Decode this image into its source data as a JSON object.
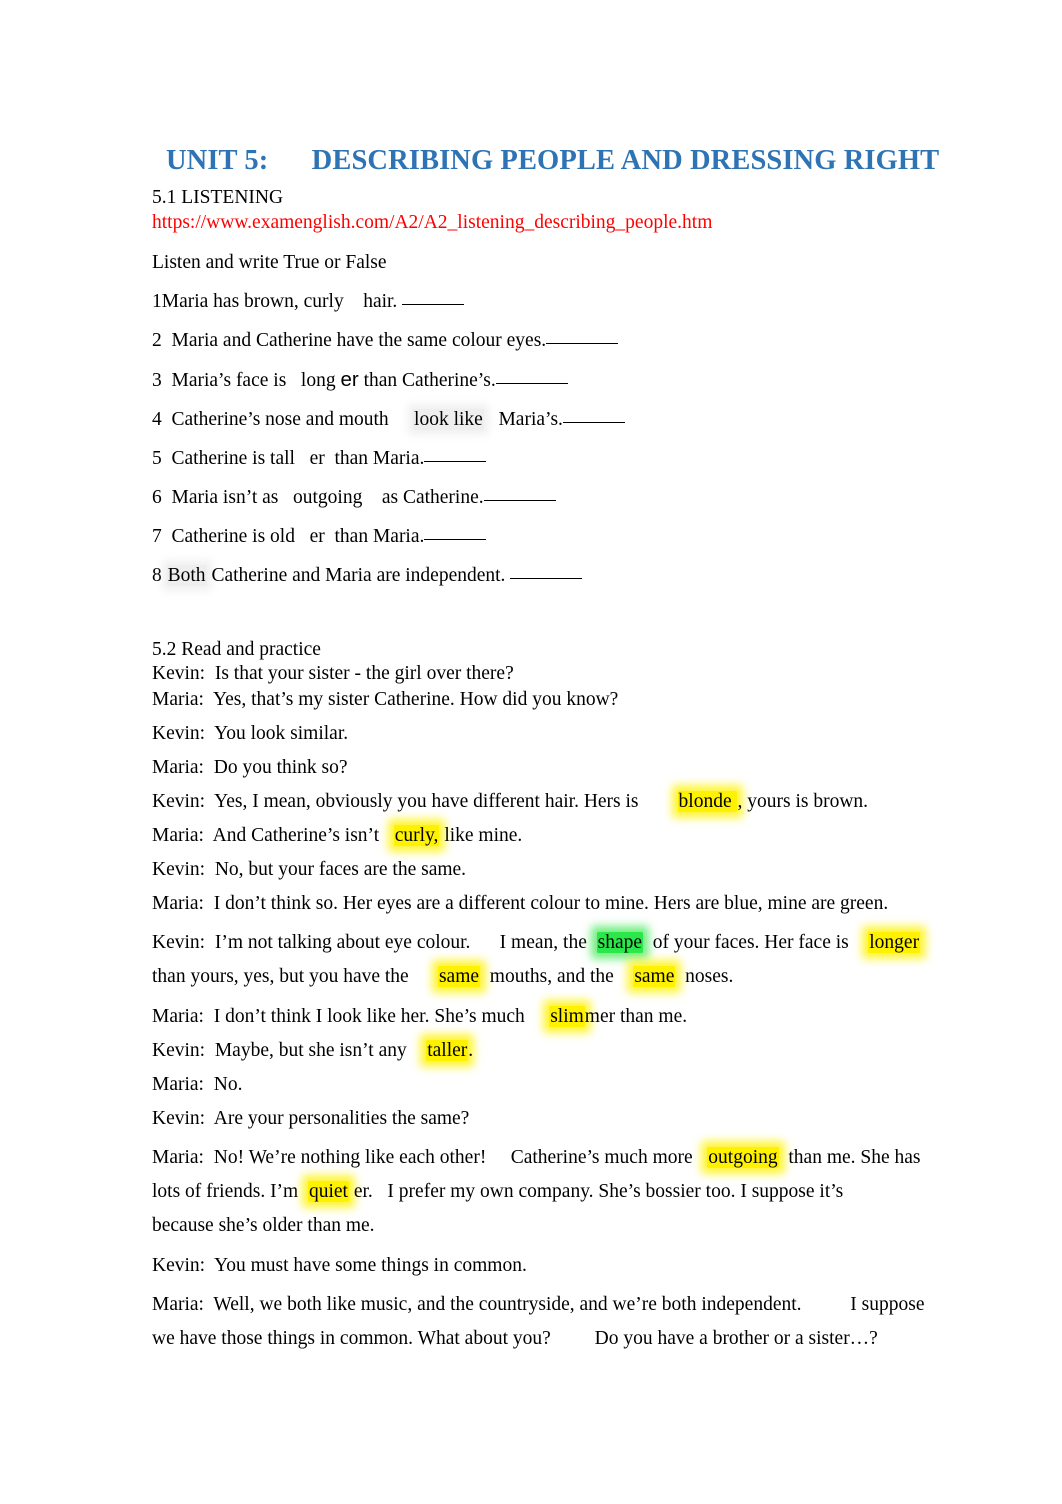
{
  "document": {
    "title": "UNIT 5:      DESCRIBING PEOPLE AND DRESSING RIGHT",
    "title_color": "#2E74B5",
    "url_color": "#FF0000",
    "highlight_yellow": "#FFF200",
    "highlight_green": "#2BE84A"
  },
  "section_51": {
    "label": "5.1 LISTENING",
    "url": "https://www.examenglish.com/A2/A2_listening_describing_people.htm",
    "instruction": "Listen and write True or False",
    "questions": [
      {
        "number": "1",
        "pre": "Maria has brown, curly    hair. ",
        "post": ""
      },
      {
        "number": "2",
        "pre": "Maria and Catherine have the same colour eyes.",
        "post": ""
      },
      {
        "number": "3",
        "pre": "Maria’s face is   long ",
        "mid_sans": "er",
        "post": " than Catherine’s."
      },
      {
        "number": "4",
        "pre": "Catherine’s nose and mouth     ",
        "ghost": "look like",
        "post": "   Maria’s."
      },
      {
        "number": "5",
        "pre": "Catherine is tall   er  than Maria.",
        "post": ""
      },
      {
        "number": "6",
        "pre": "Maria isn’t as   outgoing    as Catherine.",
        "post": ""
      },
      {
        "number": "7",
        "pre": "Catherine is old   er  than Maria.",
        "post": ""
      },
      {
        "number": "8",
        "pre": " ",
        "ghost": "Both",
        "post": " Catherine and Maria are independent. "
      }
    ]
  },
  "section_52": {
    "label": "5.2 Read and practice",
    "lines": [
      {
        "speaker": "Kevin:",
        "text": "  Is that your sister - the girl over there?"
      },
      {
        "speaker": "Maria:",
        "text": "  Yes, that’s my sister Catherine. How did you know?"
      },
      {
        "speaker": "Kevin:",
        "text": "  You look similar."
      },
      {
        "speaker": "Maria:",
        "text": "  Do you think so?"
      },
      {
        "speaker": "Kevin:",
        "pre": "  Yes, I mean, obviously you have different hair. Hers is        ",
        "hl_yellow": "blonde ",
        "post": ", yours is brown."
      },
      {
        "speaker": "Maria:",
        "pre": "  And Catherine’s isn’t   ",
        "hl_yellow": "curly,",
        "post": " like mine."
      },
      {
        "speaker": "Kevin:",
        "text": "  No, but your faces are the same."
      },
      {
        "speaker": "Maria:",
        "text": "  I don’t think so. Her eyes are a different colour to mine. Hers are blue, mine are green."
      },
      {
        "speaker": "Kevin:",
        "segments": [
          {
            "t": "  I’m not talking about eye colour.      I mean, the  ",
            "h": "none"
          },
          {
            "t": "shape",
            "h": "green"
          },
          {
            "t": "  of your faces. Her face is    ",
            "h": "none"
          },
          {
            "t": "longer",
            "h": "yellow"
          },
          {
            "t": "\nthan yours, yes, but you have the      ",
            "h": "none"
          },
          {
            "t": "same",
            "h": "yellow"
          },
          {
            "t": "  mouths, and the    ",
            "h": "none"
          },
          {
            "t": "same",
            "h": "yellow"
          },
          {
            "t": "  noses.",
            "h": "none"
          }
        ]
      },
      {
        "speaker": "Maria:",
        "pre": "  I don’t think I look like her. She’s much     ",
        "hl_yellow": "slim",
        "post": "mer than me."
      },
      {
        "speaker": "Kevin:",
        "pre": "  Maybe, but she isn’t any    ",
        "hl_yellow": "taller",
        "post": "."
      },
      {
        "speaker": "Maria:",
        "text": "  No."
      },
      {
        "speaker": "Kevin:",
        "text": "  Are your personalities the same?"
      },
      {
        "speaker": "Maria:",
        "segments": [
          {
            "t": "  No! We’re nothing like each other!     Catherine’s much more   ",
            "h": "none"
          },
          {
            "t": "outgoing",
            "h": "yellow"
          },
          {
            "t": "  than me. She has\nlots of friends. I’m  ",
            "h": "none"
          },
          {
            "t": "quiet",
            "h": "yellow"
          },
          {
            "t": " er.   I prefer my own company. She’s bossier too. I suppose it’s\nbecause she’s older than me.",
            "h": "none"
          }
        ]
      },
      {
        "speaker": "Kevin:",
        "text": "  You must have some things in common."
      },
      {
        "speaker": "Maria:",
        "text": "  Well, we both like music, and the countryside, and we’re both independent.          I suppose\nwe have those things in common. What about you?         Do you have a brother or a sister…?"
      }
    ]
  }
}
